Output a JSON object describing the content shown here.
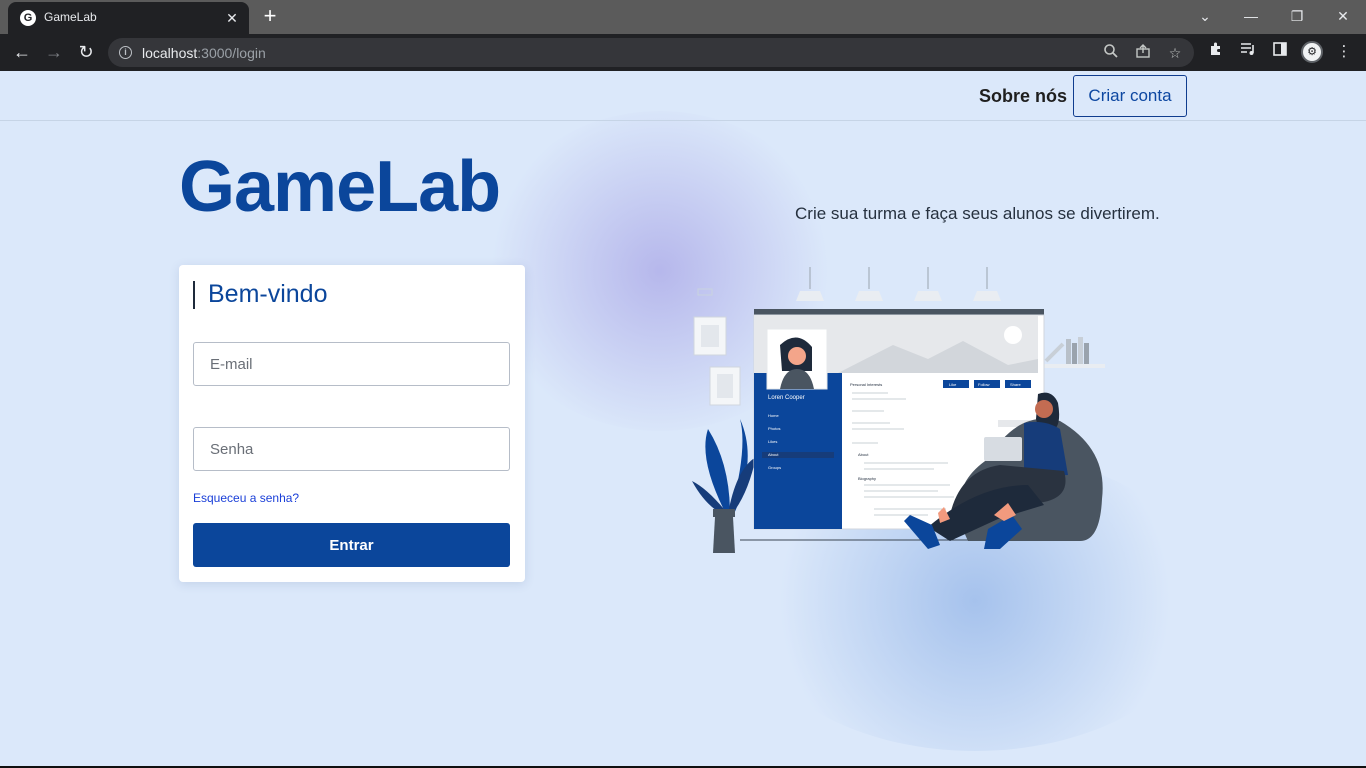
{
  "browser": {
    "tab_title": "GameLab",
    "favicon_letter": "G",
    "url_host": "localhost",
    "url_rest": ":3000/login",
    "profile_letter": "⚙"
  },
  "header": {
    "about_label": "Sobre nós",
    "create_account_label": "Criar conta"
  },
  "hero": {
    "logo": "GameLab",
    "tagline": "Crie sua turma e faça seus alunos se divertirem."
  },
  "login": {
    "title": "Bem-vindo",
    "email_placeholder": "E-mail",
    "password_placeholder": "Senha",
    "forgot_label": "Esqueceu a senha?",
    "submit_label": "Entrar"
  },
  "illustration": {
    "profile_name": "Loren Cooper",
    "menu": [
      "Home",
      "Photos",
      "Likes",
      "About",
      "Groups"
    ],
    "section_labels": [
      "Personal Interests",
      "Biography",
      "About"
    ],
    "action_buttons": [
      "Like",
      "Follow",
      "Share"
    ]
  },
  "colors": {
    "brand": "#0b469b",
    "page_bg": "#dbe8fa"
  }
}
